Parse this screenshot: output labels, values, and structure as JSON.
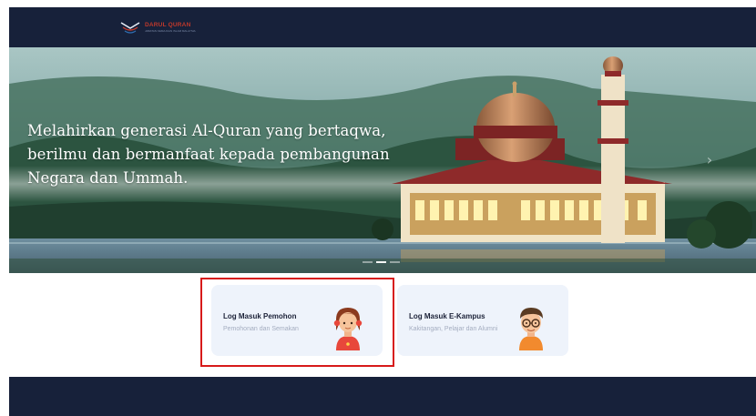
{
  "header": {
    "logo_text": "DARUL QURAN",
    "logo_sub": "JABATAN KEMAJUAN ISLAM MALAYSIA"
  },
  "hero": {
    "tagline_lines": [
      "Melahirkan generasi Al-Quran yang bertaqwa,",
      "berilmu dan bermanfaat kepada pembangunan",
      "Negara dan Ummah."
    ],
    "next_arrow": "›"
  },
  "cards": [
    {
      "title": "Log Masuk Pemohon",
      "subtitle": "Pemohonan dan Semakan"
    },
    {
      "title": "Log Masuk E-Kampus",
      "subtitle": "Kakitangan, Pelajar dan Alumni"
    }
  ],
  "colors": {
    "navbar": "#17213a",
    "card_bg": "#eef3fb",
    "highlight": "#d71a1a",
    "logo_red": "#c0392b"
  },
  "icons": {
    "card_1_avatar": "girl-avatar-icon",
    "card_2_avatar": "boy-with-glasses-avatar-icon"
  }
}
